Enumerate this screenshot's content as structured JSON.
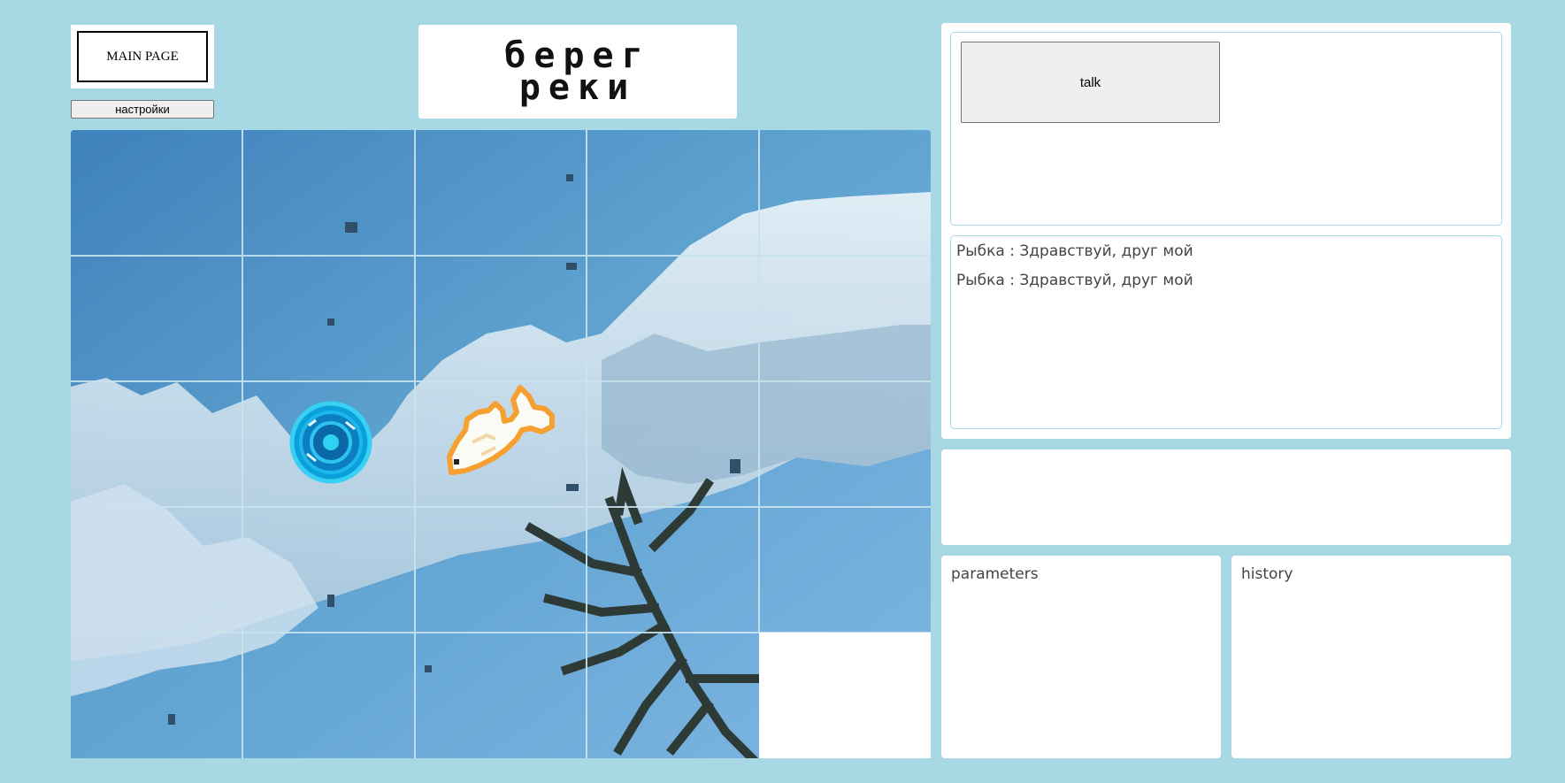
{
  "header": {
    "main_page_label": "MAIN PAGE",
    "settings_label": "настройки",
    "title_line1": "берег",
    "title_line2": "реки"
  },
  "board": {
    "rows": 5,
    "columns": 5,
    "tokens": [
      "portal-icon",
      "goldfish-icon"
    ],
    "background": "sky-with-clouds-and-branch"
  },
  "talk_panel": {
    "talk_label": "talk",
    "messages": [
      {
        "speaker": "Рыбка",
        "text": "Рыбка : Здравствуй, друг мой"
      },
      {
        "speaker": "Рыбка",
        "text": "Рыбка : Здравствуй, друг мой"
      }
    ]
  },
  "parameters": {
    "label": "parameters"
  },
  "history": {
    "label": "history"
  },
  "colors": {
    "page_background": "#a8d8e4",
    "panel_border": "#a8d8e4",
    "sky": "#5f97c6",
    "portal": "#0aa0dc",
    "fish_outline": "#f5a030"
  }
}
